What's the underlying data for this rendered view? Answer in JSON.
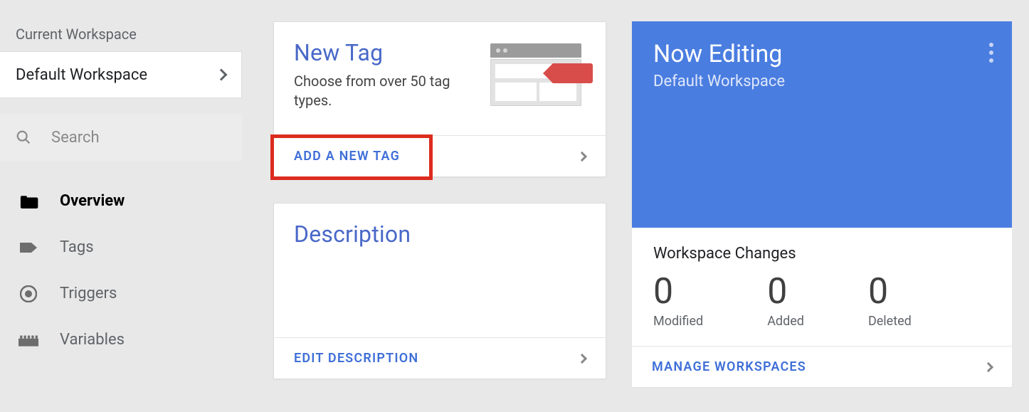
{
  "sidebar": {
    "workspace_label": "Current Workspace",
    "workspace_name": "Default Workspace",
    "search_placeholder": "Search",
    "nav": [
      {
        "label": "Overview"
      },
      {
        "label": "Tags"
      },
      {
        "label": "Triggers"
      },
      {
        "label": "Variables"
      }
    ]
  },
  "cards": {
    "new_tag": {
      "title": "New Tag",
      "subtitle": "Choose from over 50 tag types.",
      "action": "ADD A NEW TAG"
    },
    "description": {
      "title": "Description",
      "action": "EDIT DESCRIPTION"
    },
    "editing": {
      "title": "Now Editing",
      "subtitle": "Default Workspace",
      "changes_title": "Workspace Changes",
      "changes": [
        {
          "value": "0",
          "label": "Modified"
        },
        {
          "value": "0",
          "label": "Added"
        },
        {
          "value": "0",
          "label": "Deleted"
        }
      ],
      "action": "MANAGE WORKSPACES"
    }
  }
}
